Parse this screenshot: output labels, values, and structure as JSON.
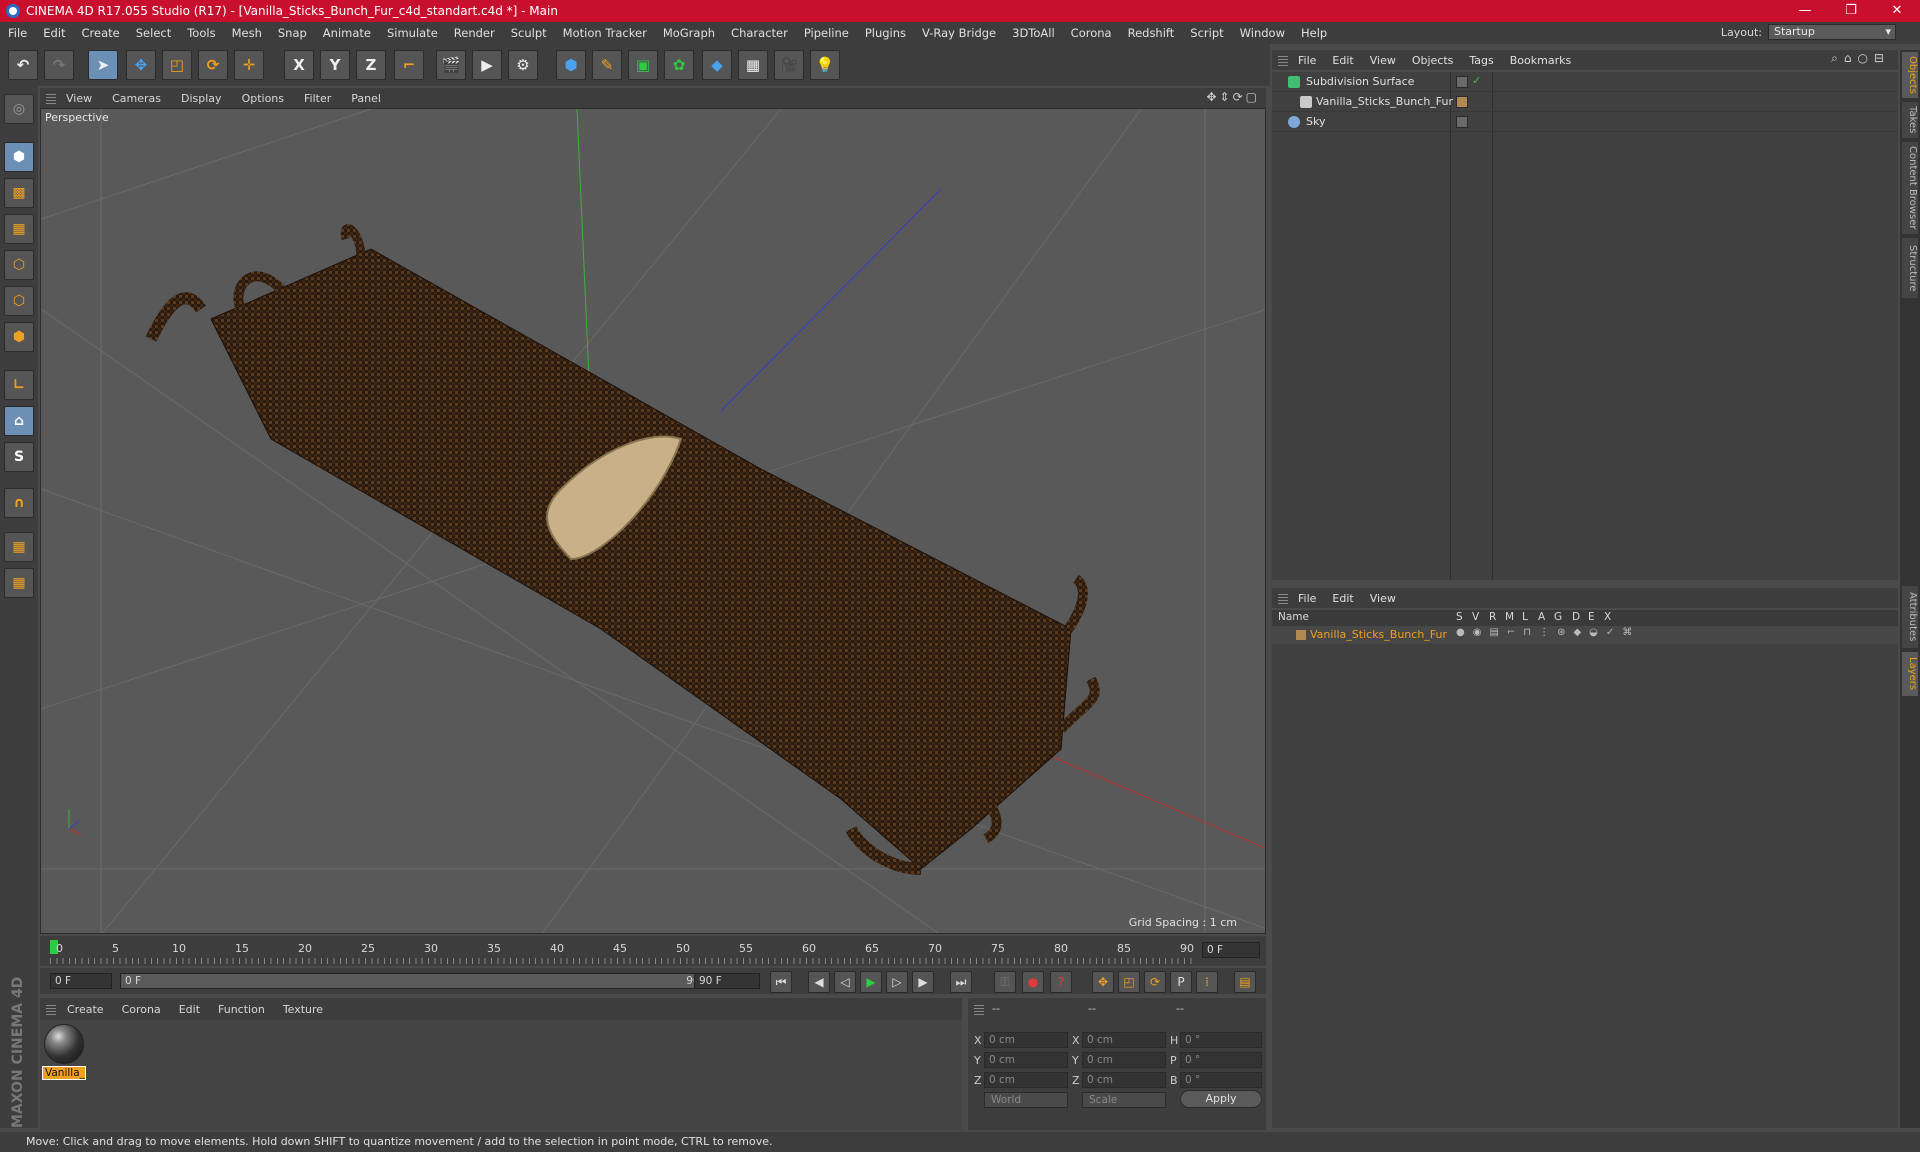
{
  "window": {
    "title": "CINEMA 4D R17.055 Studio (R17) - [Vanilla_Sticks_Bunch_Fur_c4d_standart.c4d *] - Main",
    "controls": [
      "—",
      "❐",
      "✕"
    ]
  },
  "menubar": {
    "items": [
      "File",
      "Edit",
      "Create",
      "Select",
      "Tools",
      "Mesh",
      "Snap",
      "Animate",
      "Simulate",
      "Render",
      "Sculpt",
      "Motion Tracker",
      "MoGraph",
      "Character",
      "Pipeline",
      "Plugins",
      "V-Ray Bridge",
      "3DToAll",
      "Corona",
      "Redshift",
      "Script",
      "Window",
      "Help"
    ],
    "layout_label": "Layout:",
    "layout_value": "Startup"
  },
  "toolbar": {
    "axis_x": "X",
    "axis_y": "Y",
    "axis_z": "Z"
  },
  "viewport": {
    "menu": [
      "View",
      "Cameras",
      "Display",
      "Options",
      "Filter",
      "Panel"
    ],
    "label": "Perspective",
    "grid_spacing": "Grid Spacing : 1 cm"
  },
  "timeline": {
    "ticks": [
      "0",
      "5",
      "10",
      "15",
      "20",
      "25",
      "30",
      "35",
      "40",
      "45",
      "50",
      "55",
      "60",
      "65",
      "70",
      "75",
      "80",
      "85",
      "90"
    ],
    "current_frame": "0 F",
    "start_frame": "0 F",
    "range_start": "0 F",
    "range_end": "90 F",
    "end_frame": "90 F"
  },
  "material_manager": {
    "menu": [
      "Create",
      "Corona",
      "Edit",
      "Function",
      "Texture"
    ],
    "material_name": "Vanilla_"
  },
  "coordinates": {
    "headers": [
      "--",
      "--",
      "--"
    ],
    "rows": [
      {
        "a": "X",
        "pos": "0 cm",
        "b": "X",
        "size": "0 cm",
        "c": "H",
        "rot": "0 °"
      },
      {
        "a": "Y",
        "pos": "0 cm",
        "b": "Y",
        "size": "0 cm",
        "c": "P",
        "rot": "0 °"
      },
      {
        "a": "Z",
        "pos": "0 cm",
        "b": "Z",
        "size": "0 cm",
        "c": "B",
        "rot": "0 °"
      }
    ],
    "mode": "World",
    "size_mode": "Scale",
    "apply": "Apply"
  },
  "object_manager": {
    "menu": [
      "File",
      "Edit",
      "View",
      "Objects",
      "Tags",
      "Bookmarks"
    ],
    "objects": [
      {
        "name": "Subdivision Surface",
        "color": "#3fbf6f"
      },
      {
        "name": "Vanilla_Sticks_Bunch_Fur",
        "color": "#c9c9c9"
      },
      {
        "name": "Sky",
        "color": "#7fa8d8"
      }
    ]
  },
  "layer_manager": {
    "menu": [
      "File",
      "Edit",
      "View"
    ],
    "columns": [
      "Name",
      "S",
      "V",
      "R",
      "M",
      "L",
      "A",
      "G",
      "D",
      "E",
      "X"
    ],
    "layer_name": "Vanilla_Sticks_Bunch_Fur"
  },
  "side_tabs": [
    "Objects",
    "Takes",
    "Content Browser",
    "Structure",
    "Attributes",
    "Layers"
  ],
  "status": "Move: Click and drag to move elements. Hold down SHIFT to quantize movement / add to the selection in point mode, CTRL to remove.",
  "branding": "MAXON CINEMA 4D"
}
